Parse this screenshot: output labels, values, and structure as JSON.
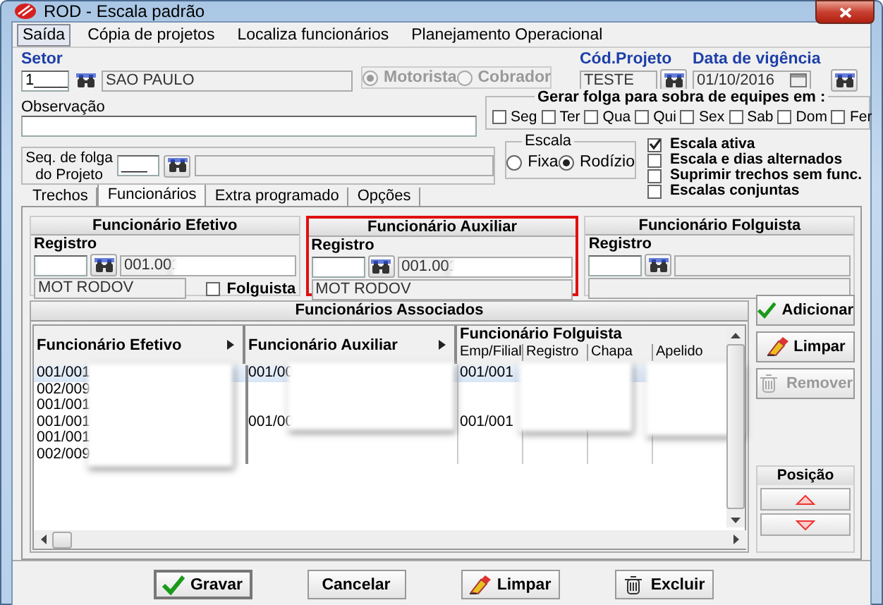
{
  "window": {
    "title": "ROD - Escala padrão"
  },
  "menu": [
    {
      "label": "Saída",
      "selected": true
    },
    {
      "label": "Cópia de projetos",
      "selected": false
    },
    {
      "label": "Localiza funcionários",
      "selected": false
    },
    {
      "label": "Planejamento Operacional",
      "selected": false
    }
  ],
  "setor": {
    "label": "Setor",
    "code": "1____",
    "name": "SAO PAULO"
  },
  "funcao": {
    "disabled": true,
    "options": [
      {
        "label": "Motorista",
        "selected": true
      },
      {
        "label": "Cobrador",
        "selected": false
      }
    ]
  },
  "cod_projeto": {
    "label": "Cód.Projeto",
    "value": "TESTE"
  },
  "data_vigencia": {
    "label": "Data de vigência",
    "value": "01/10/2016"
  },
  "observacao": {
    "label": "Observação"
  },
  "gerar_folga": {
    "title": "Gerar folga para sobra de equipes em :",
    "days": [
      {
        "label": "Seg",
        "checked": false
      },
      {
        "label": "Ter",
        "checked": false
      },
      {
        "label": "Qua",
        "checked": false
      },
      {
        "label": "Qui",
        "checked": false
      },
      {
        "label": "Sex",
        "checked": false
      },
      {
        "label": "Sab",
        "checked": false
      },
      {
        "label": "Dom",
        "checked": false
      },
      {
        "label": "Fer",
        "checked": false
      }
    ]
  },
  "seq_folga": {
    "label_lines": [
      "Seq. de folga",
      "do Projeto"
    ],
    "value": "___"
  },
  "escala": {
    "title": "Escala",
    "options": [
      {
        "label": "Fixa",
        "selected": false
      },
      {
        "label": "Rodízio",
        "selected": true
      }
    ]
  },
  "flags": [
    {
      "label": "Escala ativa",
      "checked": true
    },
    {
      "label": "Escala e dias alternados",
      "checked": false
    },
    {
      "label": "Suprimir trechos sem func.",
      "checked": false
    },
    {
      "label": "Escalas conjuntas",
      "checked": false
    }
  ],
  "tabs": [
    {
      "label": "Trechos",
      "selected": false
    },
    {
      "label": "Funcionários",
      "selected": true
    },
    {
      "label": "Extra programado",
      "selected": false
    },
    {
      "label": "Opções",
      "selected": false
    }
  ],
  "panels": [
    {
      "title": "Funcionário Efetivo",
      "registro_label": "Registro",
      "code": "001.001",
      "cargo": "MOT RODOV",
      "folguista": {
        "label": "Folguista",
        "checked": false
      },
      "highlighted": false
    },
    {
      "title": "Funcionário Auxiliar",
      "registro_label": "Registro",
      "code": "001.001",
      "cargo": "MOT RODOV",
      "highlighted": true
    },
    {
      "title": "Funcionário Folguista",
      "registro_label": "Registro",
      "highlighted": false
    }
  ],
  "associados": {
    "title": "Funcionários Associados",
    "columns": [
      "Funcionário Efetivo",
      "Funcionário Auxiliar"
    ],
    "group_column": "Funcionário Folguista",
    "subcolumns": [
      "Emp/Filial",
      "Registro",
      "Chapa",
      "Apelido"
    ],
    "rows": [
      {
        "efetivo": "001/001",
        "auxiliar": "001/00",
        "emp_filial": "001/001",
        "selected": true
      },
      {
        "efetivo": "002/009",
        "selected": false
      },
      {
        "efetivo": "001/001",
        "selected": false
      },
      {
        "efetivo": "001/001",
        "auxiliar": "001/00",
        "emp_filial": "001/001",
        "selected": false
      },
      {
        "efetivo": "001/001",
        "selected": false
      },
      {
        "efetivo": "002/009",
        "selected": false
      }
    ]
  },
  "side_buttons": [
    {
      "label": "Adicionar",
      "kind": "check",
      "disabled": false
    },
    {
      "label": "Limpar",
      "kind": "eraser",
      "disabled": false
    },
    {
      "label": "Remover",
      "kind": "trash",
      "disabled": true
    }
  ],
  "posicao": {
    "title": "Posição"
  },
  "footer_buttons": [
    {
      "label": "Gravar",
      "kind": "check",
      "default": true
    },
    {
      "label": "Cancelar",
      "kind": "plain",
      "default": false
    },
    {
      "label": "Limpar",
      "kind": "eraser",
      "default": false
    },
    {
      "label": "Excluir",
      "kind": "trash",
      "default": false
    }
  ]
}
